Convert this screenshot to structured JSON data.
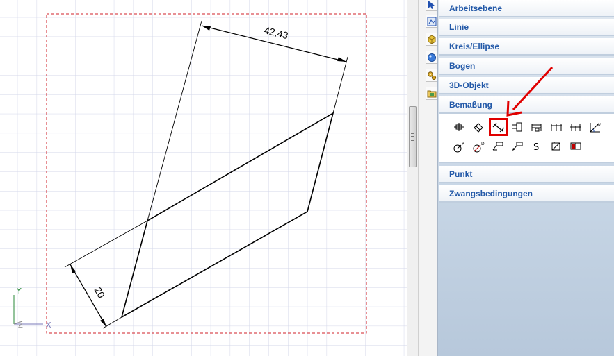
{
  "drawing": {
    "dim_top_value": "42,43",
    "dim_left_value": "20",
    "axis_y_label": "Y",
    "axis_x_label": "X"
  },
  "sidebar_icons": [
    {
      "icon": "cursor-select-icon"
    },
    {
      "icon": "image-tool-icon"
    },
    {
      "icon": "cube-yellow-icon"
    },
    {
      "icon": "sphere-blue-icon"
    },
    {
      "icon": "gears-icon"
    },
    {
      "icon": "folder-icon"
    }
  ],
  "panel": {
    "sections": [
      {
        "label": "Arbeitsebene",
        "expanded": false
      },
      {
        "label": "Linie",
        "expanded": false
      },
      {
        "label": "Kreis/Ellipse",
        "expanded": false
      },
      {
        "label": "Bogen",
        "expanded": false
      },
      {
        "label": "3D-Objekt",
        "expanded": false
      },
      {
        "label": "Bemaßung",
        "expanded": true
      },
      {
        "label": "Punkt",
        "expanded": false
      },
      {
        "label": "Zwangsbedingungen",
        "expanded": false
      }
    ],
    "bemassung_tools": [
      {
        "icon": "dimension-vertical-center-icon"
      },
      {
        "icon": "dimension-aligned-icon"
      },
      {
        "icon": "dimension-parallel-icon",
        "highlighted": true
      },
      {
        "icon": "dimension-ordinate-icon"
      },
      {
        "icon": "dimension-baseline-icon"
      },
      {
        "icon": "dimension-chain-icon"
      },
      {
        "icon": "dimension-continuous-icon"
      },
      {
        "icon": "dimension-angle-icon"
      },
      {
        "icon": "dimension-radius-icon",
        "text": "R"
      },
      {
        "icon": "dimension-diameter-icon",
        "text": "D"
      },
      {
        "icon": "leader-note-icon"
      },
      {
        "icon": "leader-arrow-icon"
      },
      {
        "icon": "symbol-s-icon",
        "text": "S"
      },
      {
        "icon": "dimension-fit-icon"
      },
      {
        "icon": "tolerance-frame-icon"
      }
    ]
  },
  "colors": {
    "section_text": "#2359a8",
    "grid": "#d3d7ea",
    "frame_dash": "#d0202a",
    "highlight": "#e00000"
  }
}
